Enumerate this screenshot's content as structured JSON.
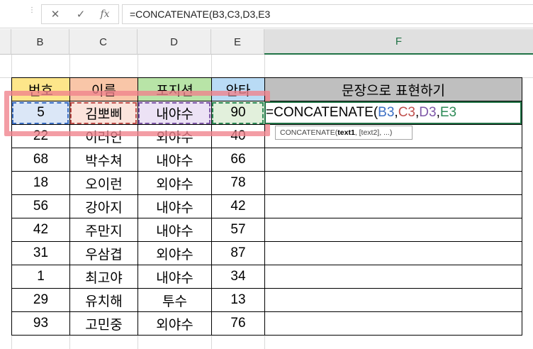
{
  "formula_bar": {
    "cancel_icon": "✕",
    "enter_icon": "✓",
    "fx_icon": "fx",
    "formula": "=CONCATENATE(B3,C3,D3,E3"
  },
  "columns": [
    "B",
    "C",
    "D",
    "E",
    "F"
  ],
  "table": {
    "headers": [
      "번호",
      "이름",
      "포지션",
      "안타",
      "문장으로 표현하기"
    ],
    "rows": [
      [
        "5",
        "김뽀삐",
        "내야수",
        "90"
      ],
      [
        "22",
        "이러언",
        "외야수",
        "40"
      ],
      [
        "68",
        "박수쳐",
        "내야수",
        "66"
      ],
      [
        "18",
        "오이런",
        "외야수",
        "78"
      ],
      [
        "56",
        "강아지",
        "내야수",
        "42"
      ],
      [
        "42",
        "주만지",
        "내야수",
        "57"
      ],
      [
        "31",
        "우삼겹",
        "외야수",
        "87"
      ],
      [
        "1",
        "최고야",
        "내야수",
        "34"
      ],
      [
        "29",
        "유치해",
        "투수",
        "13"
      ],
      [
        "93",
        "고민중",
        "외야수",
        "76"
      ]
    ]
  },
  "active_cell": {
    "prefix": "=CONCATENATE(",
    "ref_b": "B3",
    "ref_c": "C3",
    "ref_d": "D3",
    "ref_e": "E3",
    "sep": ","
  },
  "tooltip": {
    "func": "CONCATENATE(",
    "arg1": "text1",
    "rest": ", [text2], ...)"
  },
  "colors": {
    "accent_green": "#217346",
    "ref_blue": "#3b6fc4",
    "ref_red": "#c0504d",
    "ref_purple": "#7e57a8",
    "ref_green": "#2e8b57",
    "highlight_pink": "#f0828c"
  }
}
